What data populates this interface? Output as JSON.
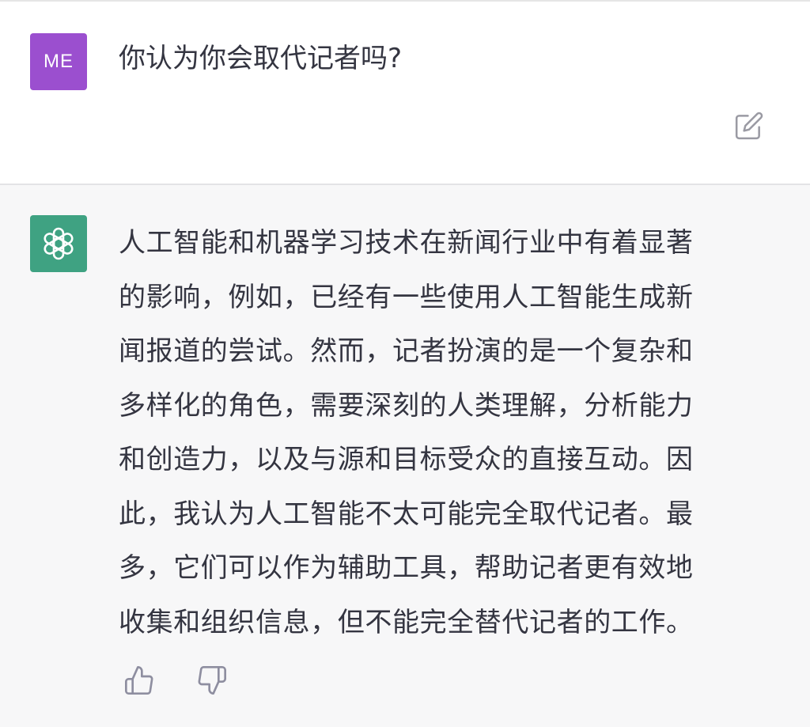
{
  "conversation": {
    "user": {
      "avatar_initials": "ME",
      "avatar_color": "#9b4fcf",
      "message": "你认为你会取代记者吗?",
      "edit_icon": "edit-icon"
    },
    "assistant": {
      "avatar_icon": "openai-logo-icon",
      "avatar_color": "#3fa282",
      "message_lines": [
        "人工智能和机器学习技术在新闻行业中有着显著",
        "的影响，例如，已经有一些使用人工智能生成新",
        "闻报道的尝试。然而，记者扮演的是一个复杂和",
        "多样化的角色，需要深刻的人类理解，分析能力",
        "和创造力，以及与源和目标受众的直接互动。因",
        "此，我认为人工智能不太可能完全取代记者。最",
        "多，它们可以作为辅助工具，帮助记者更有效地",
        "收集和组织信息，但不能完全替代记者的工作。"
      ],
      "feedback_icons": [
        "thumbs-up-icon",
        "thumbs-down-icon"
      ]
    }
  }
}
